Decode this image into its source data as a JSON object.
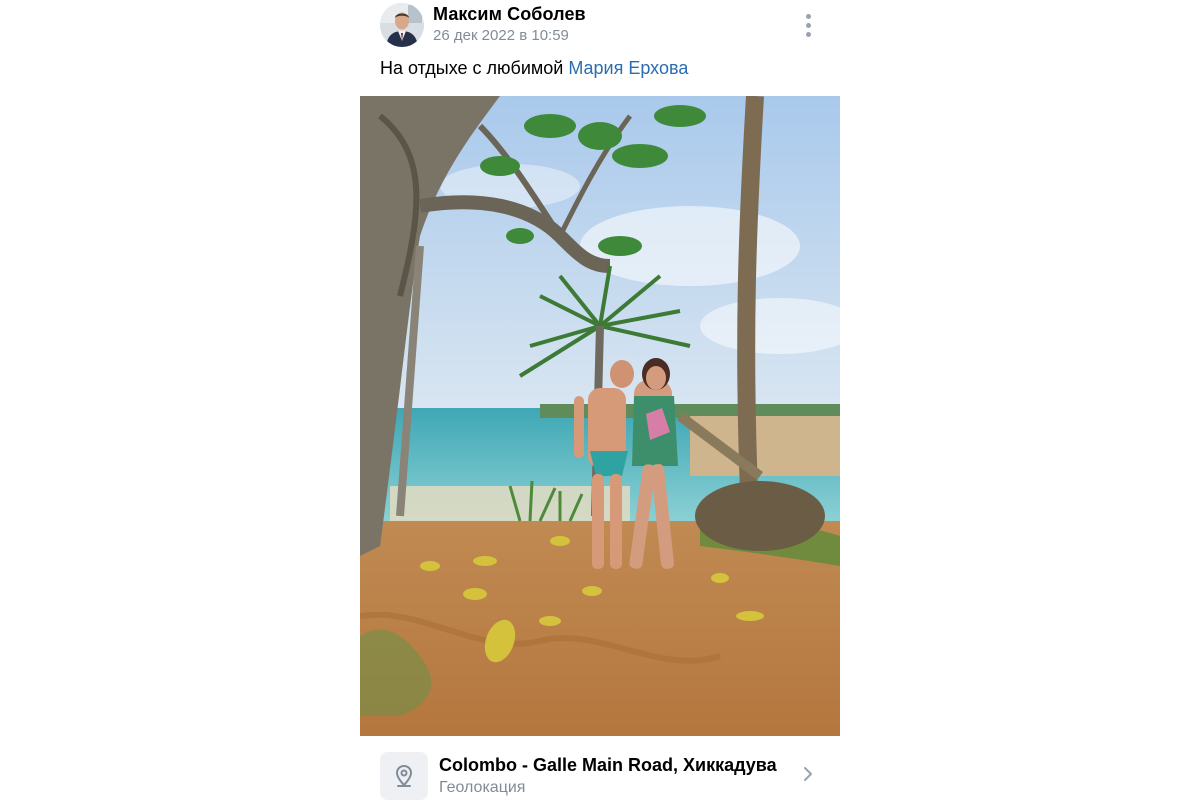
{
  "post": {
    "author": {
      "name": "Максим Соболев",
      "date": "26 дек 2022 в 10:59",
      "avatar_icon": "user-avatar-photo"
    },
    "more_icon": "vertical-dots-icon",
    "text": {
      "prefix": "На отдыхе с любимой ",
      "mention": "Мария Ерхова"
    },
    "photo": {
      "description_icon": "beach-photo"
    },
    "geo": {
      "icon": "location-pin-icon",
      "title": "Colombo - Galle Main Road, Хиккадува",
      "subtitle": "Геолокация",
      "chevron_icon": "chevron-right-icon"
    }
  },
  "colors": {
    "link": "#2a6db0",
    "secondary_text": "#818c99",
    "icon_gray": "#99a2ad",
    "geo_icon_bg": "#eef0f3"
  }
}
